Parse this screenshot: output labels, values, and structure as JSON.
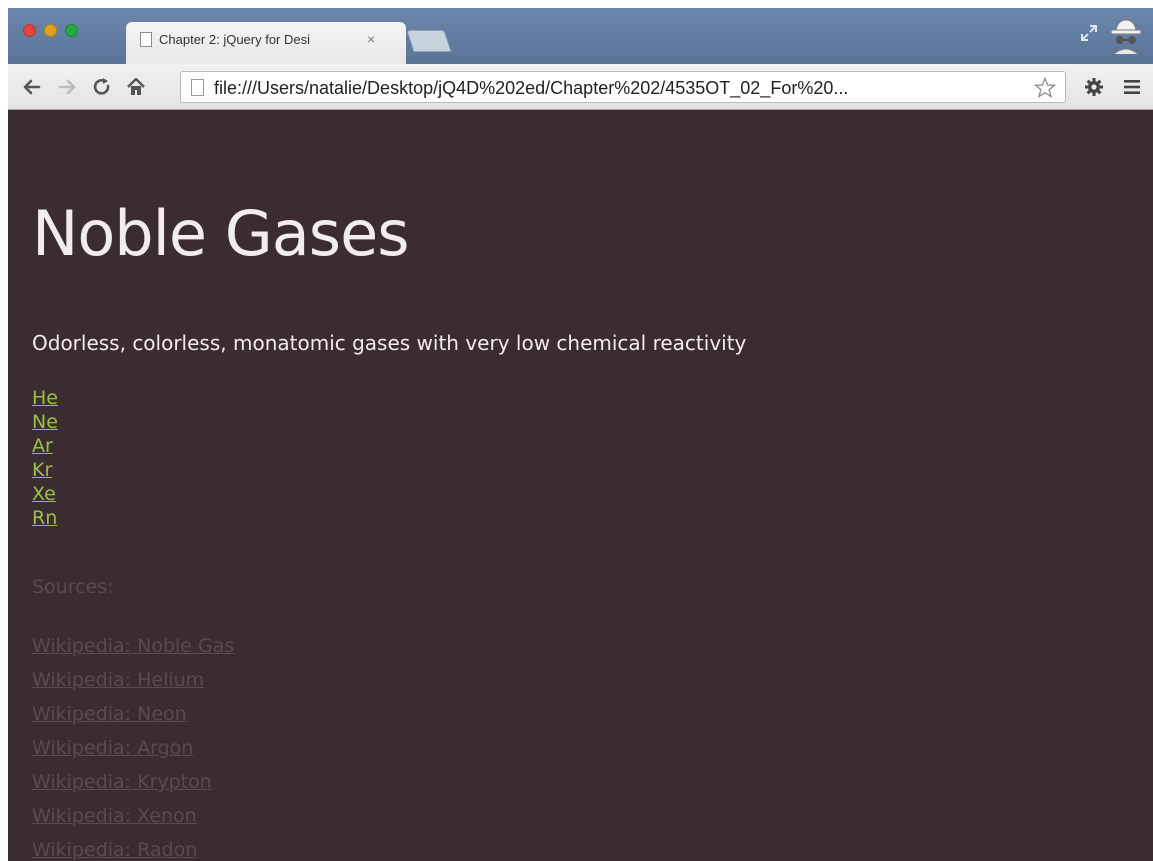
{
  "browser": {
    "tab_title": "Chapter 2: jQuery for Desi",
    "tab_close": "×",
    "url": "file:///Users/natalie/Desktop/jQ4D%202ed/Chapter%202/4535OT_02_For%20..."
  },
  "page": {
    "heading": "Noble Gases",
    "subtitle": "Odorless, colorless, monatomic gases with very low chemical reactivity",
    "elements": [
      "He",
      "Ne",
      "Ar",
      "Kr",
      "Xe",
      "Rn"
    ],
    "sources_label": "Sources:",
    "sources": [
      "Wikipedia: Noble Gas",
      "Wikipedia: Helium",
      "Wikipedia: Neon",
      "Wikipedia: Argon",
      "Wikipedia: Krypton",
      "Wikipedia: Xenon",
      "Wikipedia: Radon"
    ]
  },
  "colors": {
    "page_background": "#3a2c31",
    "heading_text": "#f2ecee",
    "element_link": "#98c046",
    "source_link": "#5a4a50"
  },
  "icons": [
    "back-icon",
    "forward-icon",
    "reload-icon",
    "home-icon",
    "page-icon",
    "star-icon",
    "settings-icon",
    "menu-icon",
    "fullscreen-icon",
    "incognito-icon"
  ]
}
